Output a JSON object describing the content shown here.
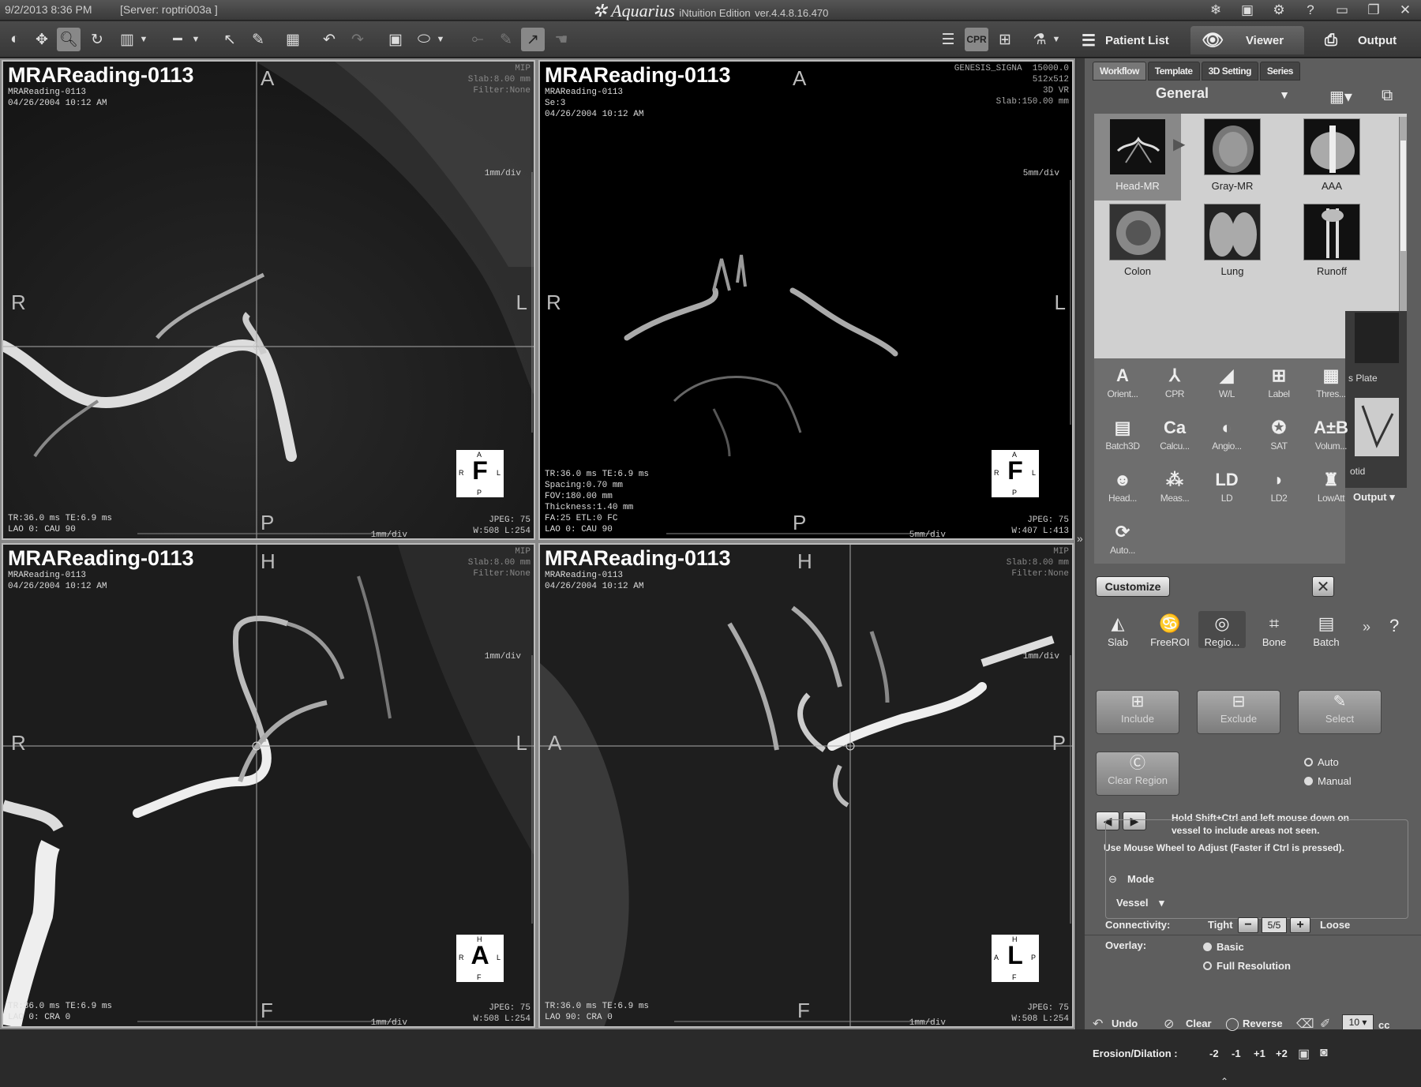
{
  "titlebar": {
    "datetime": "9/2/2013  8:36 PM",
    "server": "[Server: roptri003a ]",
    "brand": "Aquarius",
    "edition": "iNtuition Edition",
    "version": "ver.4.4.8.16.470",
    "icons": [
      "network-icon",
      "save-icon",
      "settings-gear-icon",
      "help-icon",
      "minimize-icon",
      "restore-icon",
      "close-icon"
    ]
  },
  "toolbar": {
    "nav": {
      "patient_list": "Patient List",
      "viewer": "Viewer",
      "output": "Output"
    },
    "cpr_label": "CPR",
    "tools": [
      "window-level",
      "pan",
      "zoom",
      "rotate",
      "clip",
      "measure",
      "pointer",
      "pencil",
      "layout",
      "undo",
      "redo",
      "frame",
      "shape",
      "extra1",
      "extra2",
      "extra3"
    ]
  },
  "viewports": [
    {
      "title": "MRAReading-0113",
      "sub": "MRAReading-0113\n04/26/2004 10:12 AM",
      "rt": "MIP\nSlab:8.00 mm\nFilter:None",
      "lb": "TR:36.0 ms TE:6.9 ms\nLAO 0: CAU 90",
      "rb": "JPEG: 75\nW:508 L:254",
      "scale_top": "1mm/div",
      "scale_bottom": "1mm/div",
      "orient": {
        "top": "A",
        "left": "R",
        "right": "L",
        "bottom": "P"
      },
      "cube": {
        "big": "F",
        "t": "A",
        "l": "R",
        "r": "L",
        "b": "P"
      }
    },
    {
      "title": "MRAReading-0113",
      "sub": "MRAReading-0113\nSe:3\n04/26/2004 10:12 AM",
      "rt": "GENESIS_SIGNA  15000.0\n512x512\n3D VR\nSlab:150.00 mm",
      "lb": "TR:36.0 ms TE:6.9 ms\nSpacing:0.70 mm\nFOV:180.00 mm\nThickness:1.40 mm\nFA:25 ETL:0 FC\nLAO 0: CAU 90",
      "rb": "JPEG: 75\nW:407 L:413",
      "scale_top": "5mm/div",
      "scale_bottom": "5mm/div",
      "orient": {
        "top": "A",
        "left": "R",
        "right": "L",
        "bottom": "P"
      },
      "cube": {
        "big": "F",
        "t": "A",
        "l": "R",
        "r": "L",
        "b": "P"
      }
    },
    {
      "title": "MRAReading-0113",
      "sub": "MRAReading-0113\n04/26/2004 10:12 AM",
      "rt": "MIP\nSlab:8.00 mm\nFilter:None",
      "lb": "TR:36.0 ms TE:6.9 ms\nLAO 0: CRA 0",
      "rb": "JPEG: 75\nW:508 L:254",
      "scale_top": "1mm/div",
      "scale_bottom": "1mm/div",
      "orient": {
        "top": "H",
        "left": "R",
        "right": "L",
        "bottom": "F"
      },
      "cube": {
        "big": "A",
        "t": "H",
        "l": "R",
        "r": "L",
        "b": "F"
      }
    },
    {
      "title": "MRAReading-0113",
      "sub": "MRAReading-0113\n04/26/2004 10:12 AM",
      "rt": "MIP\nSlab:8.00 mm\nFilter:None",
      "lb": "TR:36.0 ms TE:6.9 ms\nLAO 90: CRA 0",
      "rb": "JPEG: 75\nW:508 L:254",
      "scale_top": "1mm/div",
      "scale_bottom": "1mm/div",
      "orient": {
        "top": "H",
        "left": "A",
        "right": "P",
        "bottom": "F"
      },
      "cube": {
        "big": "L",
        "t": "H",
        "l": "A",
        "r": "P",
        "b": "F"
      }
    }
  ],
  "panel": {
    "subtabs": [
      "Workflow",
      "Template",
      "3D Setting",
      "Series"
    ],
    "general": "General",
    "thumbs": [
      "Head-MR",
      "Gray-MR",
      "AAA",
      "Colon",
      "Lung",
      "Runoff"
    ],
    "popup_tools": [
      "Orient...",
      "CPR",
      "W/L",
      "Label",
      "Thres...",
      "Batch3D",
      "Calcu...",
      "Angio...",
      "SAT",
      "Volum...",
      "Head...",
      "Meas...",
      "LD",
      "LD2",
      "LowAtt",
      "Auto..."
    ],
    "popup_glyphs": [
      "A",
      "⅄",
      "◢",
      "⊞",
      "▦",
      "▤",
      "Ca",
      "◐",
      "✪",
      "A±B",
      "☻",
      "⁂",
      "LD",
      "◗",
      "♜",
      "⟳"
    ],
    "snip_text": [
      "s Plate",
      "otid"
    ],
    "output_small": "Output",
    "customize": "Customize",
    "bottom_tools": [
      "Slab",
      "FreeROI",
      "Regio...",
      "Bone",
      "Batch"
    ],
    "region_buttons": {
      "include": "Include",
      "exclude": "Exclude",
      "select": "Select",
      "clear": "Clear Region"
    },
    "radio_auto": "Auto",
    "radio_manual": "Manual",
    "hint1": "Hold Shift+Ctrl and left mouse down on",
    "hint2": "vessel to include areas not seen.",
    "hint3": "Use Mouse Wheel to Adjust (Faster if Ctrl is pressed).",
    "mode_label": "Mode",
    "mode_value": "Vessel",
    "connectivity_label": "Connectivity:",
    "tight": "Tight",
    "loose": "Loose",
    "connectivity_value": "5/5",
    "overlay_label": "Overlay:",
    "overlay_basic": "Basic",
    "overlay_full": "Full Resolution",
    "footer": {
      "undo": "Undo",
      "clear": "Clear",
      "reverse": "Reverse",
      "cc_value": "10",
      "cc_unit": "cc",
      "erosion_label": "Erosion/Dilation :",
      "erosion_steps": [
        "-2",
        "-1",
        "+1",
        "+2"
      ]
    }
  },
  "colors": {
    "panel_bg": "#5e5e5e",
    "titlebar_bg": "#444444",
    "viewport_bg": "#000000"
  }
}
